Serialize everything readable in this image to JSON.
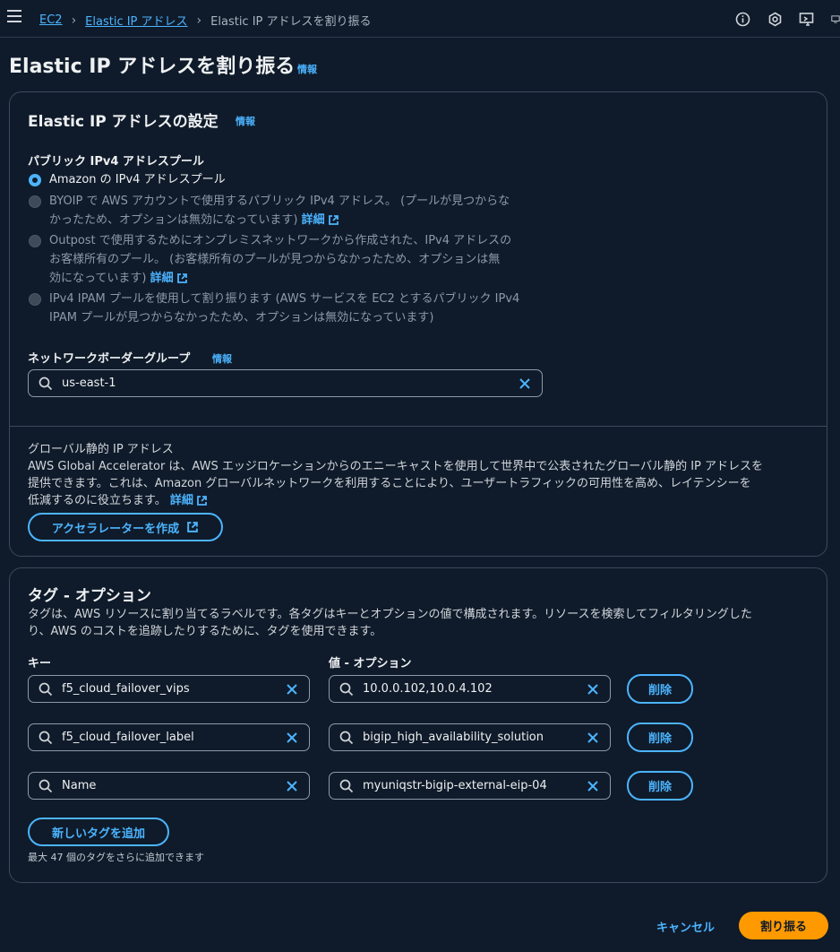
{
  "breadcrumb": {
    "items": [
      "EC2",
      "Elastic IP アドレス"
    ],
    "current": "Elastic IP アドレスを割り振る"
  },
  "page": {
    "title": "Elastic IP アドレスを割り振る",
    "info": "情報"
  },
  "settings": {
    "title": "Elastic IP アドレスの設定",
    "info": "情報",
    "pool_label": "パブリック IPv4 アドレスプール",
    "options": [
      {
        "line1": "Amazon の IPv4 アドレスプール",
        "selected": true
      },
      {
        "line1": "BYOIP で AWS アカウントで使用するパブリック IPv4 アドレス。 (プールが見つからな",
        "line2": "かったため、オプションは無効になっています)",
        "link": "詳細"
      },
      {
        "line1": "Outpost で使用するためにオンプレミスネットワークから作成された、IPv4 アドレスの",
        "line2": "お客様所有のプール。 (お客様所有のプールが見つからなかったため、オプションは無",
        "line3": "効になっています)",
        "link": "詳細"
      },
      {
        "line1": "IPv4 IPAM プールを使用して割り振ります (AWS サービスを EC2 とするパブリック IPv4",
        "line2": "IPAM プールが見つからなかったため、オプションは無効になっています)"
      }
    ],
    "nbg_label": "ネットワークボーダーグループ",
    "nbg_info": "情報",
    "nbg_value": "us-east-1"
  },
  "global": {
    "title": "グローバル静的 IP アドレス",
    "line1": "AWS Global Accelerator は、AWS エッジロケーションからのエニーキャストを使用して世界中で公表されたグローバル静的 IP アドレスを",
    "line2": "提供できます。これは、Amazon グローバルネットワークを利用することにより、ユーザートラフィックの可用性を高め、レイテンシーを",
    "line3": "低減するのに役立ちます。",
    "link": "詳細",
    "button": "アクセラレーターを作成"
  },
  "tags": {
    "title": "タグ - オプション",
    "desc1": "タグは、AWS リソースに割り当てるラベルです。各タグはキーとオプションの値で構成されます。リソースを検索してフィルタリングした",
    "desc2": "り、AWS のコストを追跡したりするために、タグを使用できます。",
    "key_header": "キー",
    "value_header": "値 - オプション",
    "rows": [
      {
        "key": "f5_cloud_failover_vips",
        "value": "10.0.0.102,10.0.4.102",
        "remove": "削除"
      },
      {
        "key": "f5_cloud_failover_label",
        "value": "bigip_high_availability_solution",
        "remove": "削除"
      },
      {
        "key": "Name",
        "value": "myuniqstr-bigip-external-eip-04",
        "remove": "削除"
      }
    ],
    "add_button": "新しいタグを追加",
    "limit_note": "最大 47 個のタグをさらに追加できます"
  },
  "footer": {
    "cancel": "キャンセル",
    "submit": "割り振る"
  },
  "colors": {
    "accent": "#4cb4ff",
    "primary": "#ff9900",
    "background": "#0f1b2a"
  }
}
